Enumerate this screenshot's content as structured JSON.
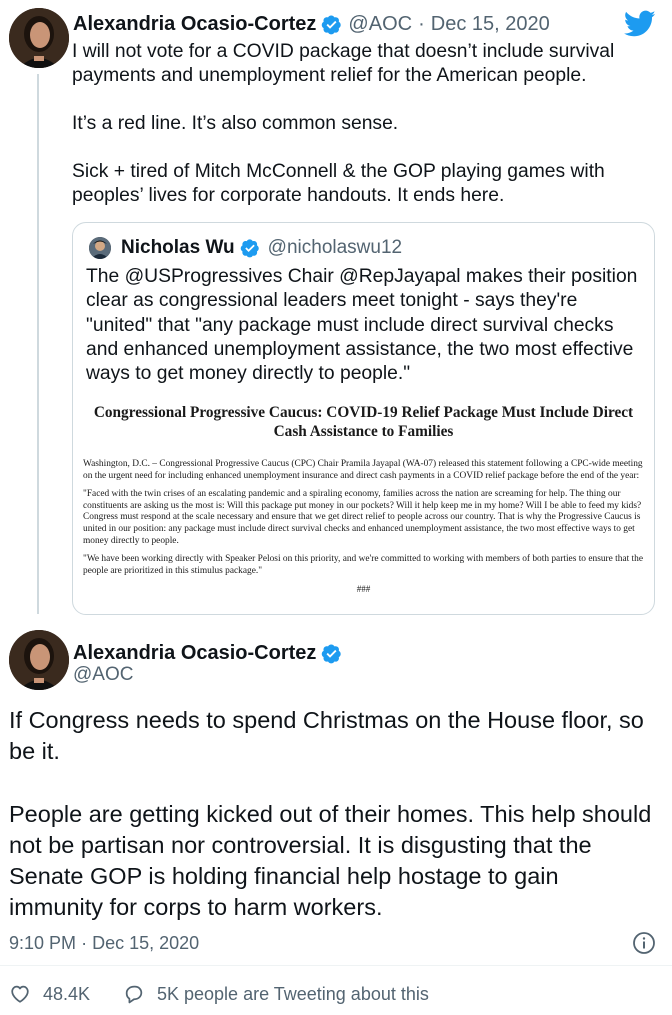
{
  "quoted_parent_tweet": {
    "author_name": "Alexandria Ocasio-Cortez",
    "author_handle": "@AOC",
    "separator": "·",
    "date": "Dec 15, 2020",
    "paragraphs": [
      "I will not vote for a COVID package that doesn’t include survival payments and unemployment relief for the American people.",
      "It’s a red line. It’s also common sense.",
      "Sick + tired of Mitch McConnell & the GOP playing games with peoples’ lives for corporate handouts. It ends here."
    ],
    "quote": {
      "author_name": "Nicholas Wu",
      "author_handle": "@nicholaswu12",
      "text": "The @USProgressives Chair @RepJayapal makes their position clear as congressional leaders meet tonight - says they're \"united\" that \"any package must include direct survival checks and enhanced unemployment assistance, the two most effective ways to get money directly to people.\"",
      "press_release": {
        "title": "Congressional Progressive Caucus: COVID-19 Relief Package Must Include Direct Cash Assistance to Families",
        "paragraphs": [
          "Washington, D.C. – Congressional Progressive Caucus (CPC) Chair Pramila Jayapal (WA-07) released this statement following a CPC-wide meeting on the urgent need for including enhanced unemployment insurance and direct cash payments in a COVID relief package before the end of the year:",
          "\"Faced with the twin crises of an escalating pandemic and a spiraling economy, families across the nation are screaming for help. The thing our constituents are asking us the most is: Will this package put money in our pockets? Will it help keep me in my home? Will I be able to feed my kids? Congress must respond at the scale necessary and ensure that we get direct relief to people across our country. That is why the Progressive Caucus is united in our position: any package must include direct survival checks and enhanced unemployment assistance, the two most effective ways to get money directly to people.",
          "\"We have been working directly with Speaker Pelosi on this priority, and we're committed to working with members of both parties to ensure that the people are prioritized in this stimulus package.\""
        ],
        "end_mark": "###"
      }
    }
  },
  "main_tweet": {
    "author_name": "Alexandria Ocasio-Cortez",
    "author_handle": "@AOC",
    "paragraphs": [
      "If Congress needs to spend Christmas on the House floor, so be it.",
      "People are getting kicked out of their homes. This help should not be partisan nor controversial. It is disgusting that the Senate GOP is holding financial help hostage to gain immunity for corps to harm workers."
    ],
    "time": "9:10 PM",
    "separator": "·",
    "date": "Dec 15, 2020",
    "likes": "48.4K",
    "tweeting_about": "5K people are Tweeting about this"
  },
  "icons": {
    "logo": "twitter-bird-icon",
    "verified": "verified-badge-icon",
    "info": "info-icon",
    "like": "heart-icon",
    "reply": "speech-bubble-icon"
  },
  "colors": {
    "brand": "#1d9bf0",
    "text": "#0f1419",
    "secondary": "#536471",
    "border": "#cfd9de"
  }
}
